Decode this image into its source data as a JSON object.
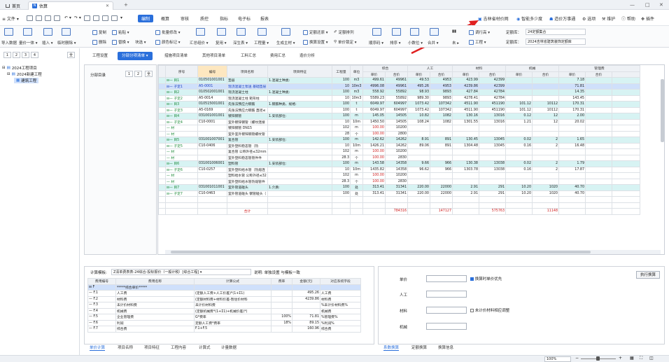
{
  "titlebar": {
    "tabs": [
      {
        "label": "首页"
      },
      {
        "label": "估算"
      }
    ],
    "add_label": "+",
    "win": {
      "min": "—",
      "max": "□",
      "close": "✕"
    }
  },
  "menubar": {
    "file": "≡ 文件 ▾",
    "menus": [
      {
        "label": "编制"
      },
      {
        "label": "概算"
      },
      {
        "label": "审核"
      },
      {
        "label": "质控"
      },
      {
        "label": "指标"
      },
      {
        "label": "电子标"
      },
      {
        "label": "报表"
      }
    ],
    "right": [
      {
        "label": "吉林省材价网"
      },
      {
        "label": "智能多少度"
      },
      {
        "label": "造价万事通"
      },
      {
        "label": "选项"
      },
      {
        "label": "维护"
      },
      {
        "label": "帮助"
      },
      {
        "label": "插件"
      }
    ]
  },
  "ribbon": {
    "row1": [
      {
        "label": "复制"
      },
      {
        "label": "粘贴 ▾"
      },
      {
        "label": "批量修改 ▾"
      },
      {
        "label": "定额还原 ▾"
      },
      {
        "label": "定额排列"
      }
    ],
    "row2": [
      {
        "label": "导入数据"
      },
      {
        "label": "量价一体 ▾"
      },
      {
        "label": "插入 ▾"
      },
      {
        "label": "临时删除 ▾"
      },
      {
        "label": "删除"
      },
      {
        "label": "替换 ▾"
      },
      {
        "label": "块选 ▾"
      },
      {
        "label": "颜色标记 ▾"
      },
      {
        "label": "汇总组价 ▾"
      },
      {
        "label": "复用 ▾"
      },
      {
        "label": "深生表 ▾"
      },
      {
        "label": "工程量 ▾"
      },
      {
        "label": "生成主材 ▾"
      },
      {
        "label": "换算设置 ▾"
      },
      {
        "label": "单价锁定 ▾"
      },
      {
        "label": "顺序码 ▾"
      },
      {
        "label": "排序 ▾"
      },
      {
        "label": "小数位 ▾"
      },
      {
        "label": "合并 ▾"
      }
    ],
    "right1": [
      {
        "label": "调行高 ▾"
      },
      {
        "label": "定额库："
      },
      {
        "label": "定额库："
      }
    ],
    "right2": [
      {
        "label": "工程 ▾"
      }
    ],
    "sel1": "24定额集合",
    "sel2": "2024吉林省建筑装饰定额库"
  },
  "tree": {
    "buttons": [
      "1",
      "2",
      "3",
      "4"
    ],
    "all": "全",
    "nodes": [
      {
        "label": "2024工程项目"
      },
      {
        "label": "2024新建工程"
      },
      {
        "label": "建筑工程"
      }
    ]
  },
  "subtabs": [
    {
      "label": "工程设置"
    },
    {
      "label": "分部分项清单 ▾"
    },
    {
      "label": "措施项目清单"
    },
    {
      "label": "其他项目清单"
    },
    {
      "label": "工料汇总"
    },
    {
      "label": "费用汇总"
    },
    {
      "label": "造价分析"
    }
  ],
  "secpanel": {
    "title": "分部目录",
    "buttons": [
      "1",
      "2"
    ],
    "all": "全"
  },
  "grid": {
    "headers": {
      "seq": "序号",
      "code": "编号",
      "name": "项目名称",
      "feature": "项目特征",
      "qty": "工程量",
      "unit": "单位",
      "zonghe": "综合",
      "rengong": "人工",
      "cailiao": "材料",
      "jixie": "机械",
      "guanli": "管理费",
      "price": "单价",
      "total": "合价"
    },
    "rows": [
      {
        "seq": "⊟— 目1",
        "code": "010501001001",
        "name": "垫层",
        "feat": "1.混凝土种类:",
        "qty": "100",
        "unit": "m3",
        "zp": "499.61",
        "zt": "49961",
        "rp": "49.53",
        "rt": "4953",
        "cp": "423.99",
        "ct": "42399",
        "jp": "",
        "jt": "",
        "gp": "7.18",
        "cls": "hl",
        "c": "green"
      },
      {
        "seq": "⊟— 子定1",
        "code": "A5-0001",
        "name": "现浇混凝土泵送 基础垫层",
        "feat": "",
        "qty": "10",
        "unit": "10m3",
        "zp": "4996.08",
        "zt": "49961",
        "rp": "495.26",
        "rt": "4953",
        "cp": "4239.86",
        "ct": "42399",
        "jp": "",
        "jt": "",
        "gp": "71.81",
        "cls": "sel-row",
        "c": "blue"
      },
      {
        "seq": "⊟— 目2",
        "code": "010502001001",
        "name": "现浇混凝土柱",
        "feat": "1.混凝土种类:",
        "qty": "100",
        "unit": "m3",
        "zp": "558.92",
        "zt": "55892",
        "rp": "98.93",
        "rt": "9893",
        "cp": "427.84",
        "ct": "42784",
        "jp": "",
        "jt": "",
        "gp": "14.35",
        "cls": "hl",
        "c": "green"
      },
      {
        "seq": "⊟— 子定2",
        "code": "A5-0014",
        "name": "现浇混凝土柱 矩形柱",
        "feat": "",
        "qty": "10",
        "unit": "10m3",
        "zp": "5589.23",
        "zt": "55892",
        "rp": "989.30",
        "rt": "9893",
        "cp": "4278.41",
        "ct": "42784",
        "jp": "",
        "jt": "",
        "gp": "143.45",
        "cls": "",
        "c": "green"
      },
      {
        "seq": "⊟— 目3",
        "code": "010515001001",
        "name": "先张法预应力钢筋",
        "feat": "1.钢筋种类、规格:",
        "qty": "100",
        "unit": "t",
        "zp": "6049.97",
        "zt": "604997",
        "rp": "1073.42",
        "rt": "107342",
        "cp": "4511.90",
        "ct": "451190",
        "jp": "101.12",
        "jt": "10112",
        "gp": "170.31",
        "cls": "hl",
        "c": "green"
      },
      {
        "seq": "⊟— 子定3",
        "code": "A5-0169",
        "name": "先张法预应力钢筋 直径≤",
        "feat": "",
        "qty": "100",
        "unit": "t",
        "zp": "6049.97",
        "zt": "604997",
        "rp": "1073.42",
        "rt": "107342",
        "cp": "4511.90",
        "ct": "451190",
        "jp": "101.12",
        "jt": "10112",
        "gp": "170.31",
        "cls": "",
        "c": "green"
      },
      {
        "seq": "⊟— 目4",
        "code": "031001001001",
        "name": "镀锌钢管",
        "feat": "1.安装部位:",
        "qty": "100",
        "unit": "m",
        "zp": "145.05",
        "zt": "14505",
        "rp": "10.82",
        "rt": "1082",
        "cp": "130.16",
        "ct": "13016",
        "jp": "0.12",
        "jt": "12",
        "gp": "2.00",
        "cls": "hl",
        "c": "green"
      },
      {
        "seq": "⊟— 子定4",
        "code": "C10-0001",
        "name": "室外镀锌钢管（螺纹连接",
        "feat": "",
        "qty": "10",
        "unit": "10m",
        "zp": "1450.50",
        "zt": "14505",
        "rp": "108.24",
        "rt": "1082",
        "cp": "1301.55",
        "ct": "13016",
        "jp": "1.21",
        "jt": "12",
        "gp": "20.02",
        "cls": "",
        "c": "green"
      },
      {
        "seq": "— 材",
        "code": "",
        "name": "镀锌钢管 DN15",
        "feat": "",
        "qty": "102",
        "unit": "m",
        "zp": "100.00",
        "zt": "10200",
        "rp": "",
        "rt": "",
        "cp": "",
        "ct": "",
        "jp": "",
        "jt": "",
        "gp": "",
        "cls": "",
        "c": "green",
        "zred": true
      },
      {
        "seq": "— 材",
        "code": "",
        "name": "室外室外镀锌钢管螺纹管",
        "feat": "",
        "qty": "28",
        "unit": "个",
        "zp": "100.00",
        "zt": "2800",
        "rp": "",
        "rt": "",
        "cp": "",
        "ct": "",
        "jp": "",
        "jt": "",
        "gp": "",
        "cls": "",
        "c": "green",
        "zred": true
      },
      {
        "seq": "⊟— 目5",
        "code": "031001007001",
        "name": "复合管",
        "feat": "1.安装部位:",
        "qty": "100",
        "unit": "m",
        "zp": "142.62",
        "zt": "14262",
        "rp": "8.91",
        "rt": "891",
        "cp": "130.45",
        "ct": "13045",
        "jp": "0.02",
        "jt": "2",
        "gp": "1.65",
        "cls": "hl",
        "c": "green"
      },
      {
        "seq": "⊟— 子定5",
        "code": "C10-0406",
        "name": "室外塑料稳态管（热",
        "feat": "",
        "qty": "10",
        "unit": "10m",
        "zp": "1426.21",
        "zt": "14262",
        "rp": "89.06",
        "rt": "891",
        "cp": "1304.48",
        "ct": "13045",
        "jp": "0.16",
        "jt": "2",
        "gp": "16.48",
        "cls": "",
        "c": "green"
      },
      {
        "seq": "— 材",
        "code": "",
        "name": "复合管 公称外径≤32mm",
        "feat": "",
        "qty": "102",
        "unit": "m",
        "zp": "100.00",
        "zt": "10200",
        "rp": "",
        "rt": "",
        "cp": "",
        "ct": "",
        "jp": "",
        "jt": "",
        "gp": "",
        "cls": "",
        "c": "green",
        "zred": true
      },
      {
        "seq": "— 材",
        "code": "",
        "name": "室外塑料稳态管管件件",
        "feat": "",
        "qty": "28.3",
        "unit": "个",
        "zp": "100.00",
        "zt": "2830",
        "rp": "",
        "rt": "",
        "cp": "",
        "ct": "",
        "jp": "",
        "jt": "",
        "gp": "",
        "cls": "",
        "c": "green",
        "zred": true
      },
      {
        "seq": "⊟— 目6",
        "code": "031001006001",
        "name": "塑料管",
        "feat": "1.安装部位:",
        "qty": "100",
        "unit": "m",
        "zp": "143.58",
        "zt": "14358",
        "rp": "9.66",
        "rt": "966",
        "cp": "130.38",
        "ct": "13038",
        "jp": "0.02",
        "jt": "2",
        "gp": "1.79",
        "cls": "hl",
        "c": "green"
      },
      {
        "seq": "⊟— 子定6",
        "code": "C10-0257",
        "name": "室外塑料给水管（热熔连",
        "feat": "",
        "qty": "10",
        "unit": "10m",
        "zp": "1435.82",
        "zt": "14358",
        "rp": "96.62",
        "rt": "966",
        "cp": "1303.78",
        "ct": "13038",
        "jp": "0.16",
        "jt": "2",
        "gp": "17.87",
        "cls": "",
        "c": "green"
      },
      {
        "seq": "— 材",
        "code": "",
        "name": "塑料给水管 公称外径≤32",
        "feat": "",
        "qty": "102",
        "unit": "m",
        "zp": "100.00",
        "zt": "10200",
        "rp": "",
        "rt": "",
        "cp": "",
        "ct": "",
        "jp": "",
        "jt": "",
        "gp": "",
        "cls": "",
        "c": "green",
        "zred": true
      },
      {
        "seq": "— 材",
        "code": "",
        "name": "室外塑料给水管热熔管件",
        "feat": "",
        "qty": "28.3",
        "unit": "个",
        "zp": "100.00",
        "zt": "2830",
        "rp": "",
        "rt": "",
        "cp": "",
        "ct": "",
        "jp": "",
        "jt": "",
        "gp": "",
        "cls": "",
        "c": "green",
        "zred": true
      },
      {
        "seq": "⊟— 目7",
        "code": "031001011001",
        "name": "室外管道碰头",
        "feat": "1.介质:",
        "qty": "100",
        "unit": "处",
        "zp": "313.41",
        "zt": "31341",
        "rp": "220.00",
        "rt": "22000",
        "cp": "2.91",
        "ct": "291",
        "jp": "10.20",
        "jt": "1020",
        "gp": "40.70",
        "cls": "hl",
        "c": "green"
      },
      {
        "seq": "⊟— 子定7",
        "code": "C10-0463",
        "name": "室外管道碰头 钢管碰头（",
        "feat": "",
        "qty": "100",
        "unit": "处",
        "zp": "313.41",
        "zt": "31341",
        "rp": "220.00",
        "rt": "22000",
        "cp": "2.91",
        "ct": "291",
        "jp": "10.20",
        "jt": "1020",
        "gp": "40.70",
        "cls": "",
        "c": "green"
      }
    ],
    "total": {
      "label": "合计",
      "zt": "784316",
      "rt": "147127",
      "ct": "575763",
      "jt": "11148"
    }
  },
  "calc": {
    "template_label": "计算模板:",
    "template_value": "Z清单费表表-24综合-投标报价（一般计税）[综合工程] ▾",
    "desc_label": "说明: 单独设置 与模板一致",
    "headers": {
      "code": "费用编号",
      "name": "费用名称",
      "formula": "计算公式",
      "rate": "费率",
      "amount": "金额(元)",
      "field": "对应系统字段"
    },
    "rows": [
      {
        "code": "⊟ F",
        "name": "*****综合单价*****",
        "formula": "",
        "rate": "",
        "amount": "",
        "field": ""
      },
      {
        "code": "— F.1",
        "name": "人工费",
        "formula": "(定额人工费+人工价差)*(1+Σ1)",
        "rate": "",
        "amount": "495.26",
        "field": "人工费"
      },
      {
        "code": "— F.2",
        "name": "材料费",
        "formula": "(定额材料费+材料价差-暂估价材料",
        "rate": "",
        "amount": "4239.86",
        "field": "材料费"
      },
      {
        "code": "— F.3",
        "name": "未计价材料费",
        "formula": "未计价材料费",
        "rate": "",
        "amount": "",
        "field": "%未计价材料费%"
      },
      {
        "code": "— F.4",
        "name": "机械费",
        "formula": "(定额机械费*(1+Σ1)+机械价差)*(",
        "rate": "",
        "amount": "",
        "field": "机械费"
      },
      {
        "code": "— F.5",
        "name": "企业管理费",
        "formula": "G*费率",
        "rate": "100%",
        "amount": "71.81",
        "field": "%管理费%"
      },
      {
        "code": "— F.6",
        "name": "利润",
        "formula": "定额人工费*费率",
        "rate": "18%",
        "amount": "89.15",
        "field": "%利润%"
      },
      {
        "code": "— F.7",
        "name": "综合费",
        "formula": "F.1+F.5",
        "rate": "",
        "amount": "160.96",
        "field": "综合费"
      }
    ],
    "tabs": [
      {
        "label": "单价计算"
      },
      {
        "label": "项目名称"
      },
      {
        "label": "项目特征"
      },
      {
        "label": "工程内容"
      },
      {
        "label": "计算式"
      },
      {
        "label": "计量数据"
      }
    ]
  },
  "conv": {
    "price": "单价",
    "labor": "人工",
    "material": "材料",
    "machine": "机械",
    "chk1": "换算时单价优先",
    "chk2": "未计价材料相应调整",
    "exec": "执行换算",
    "tabs": [
      {
        "label": "系数换算"
      },
      {
        "label": "定额换算"
      },
      {
        "label": "换算信息"
      }
    ]
  },
  "status": {
    "zoom": "100%"
  }
}
